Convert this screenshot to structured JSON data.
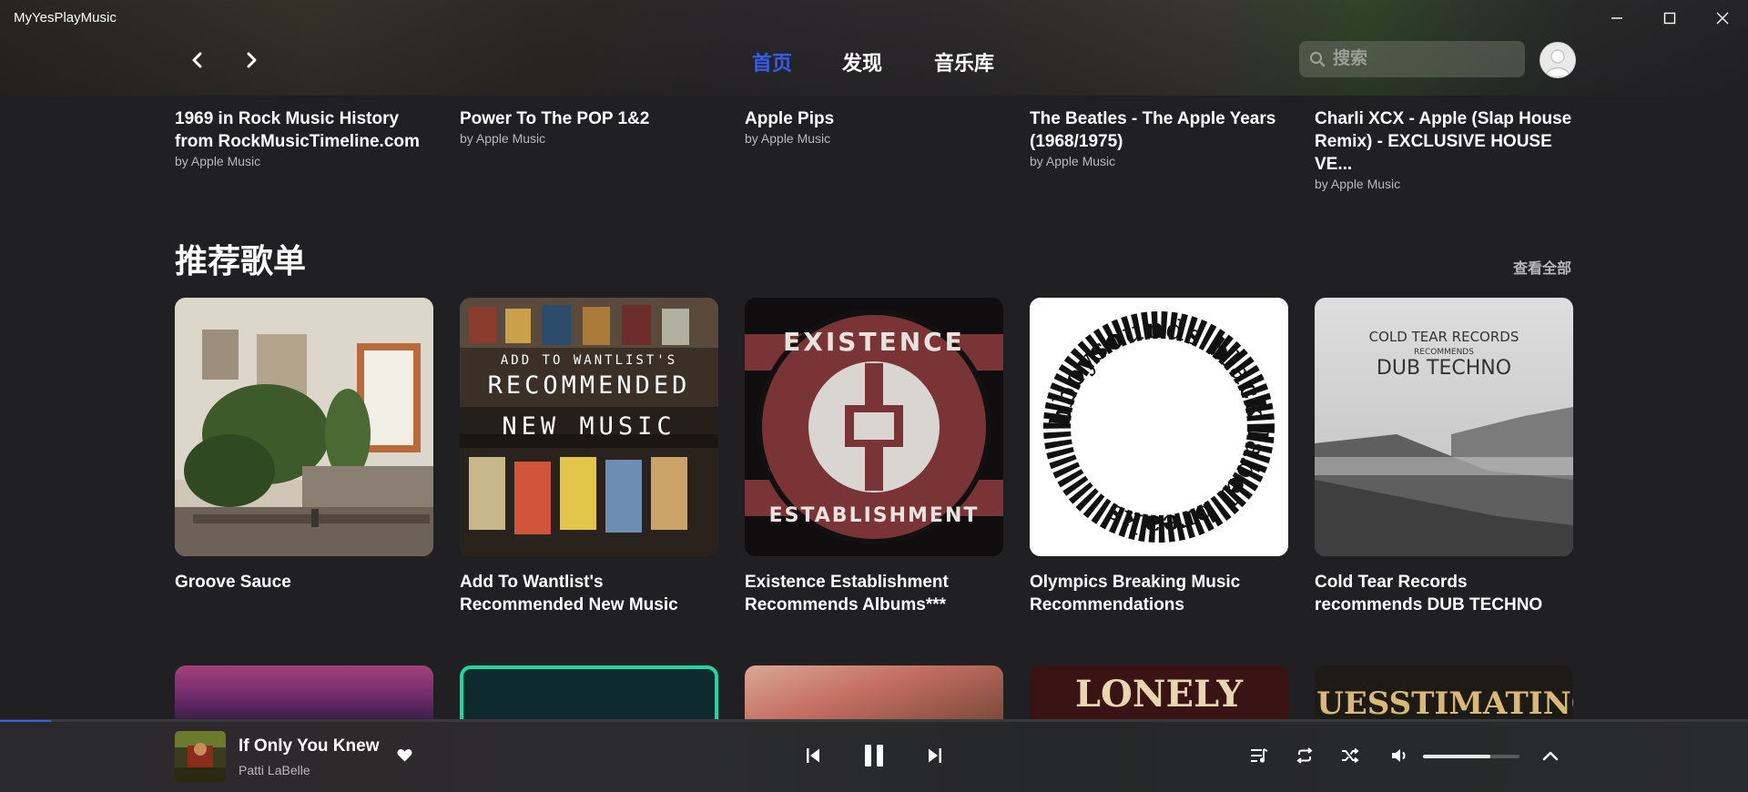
{
  "window": {
    "title": "MyYesPlayMusic"
  },
  "nav": {
    "links": [
      "首页",
      "发现",
      "音乐库"
    ],
    "search_placeholder": "搜索"
  },
  "top_row": [
    {
      "title": "1969 in Rock Music History from RockMusicTimeline.com",
      "sub": "by Apple Music"
    },
    {
      "title": "Power To The POP 1&2",
      "sub": "by Apple Music"
    },
    {
      "title": "Apple Pips",
      "sub": "by Apple Music"
    },
    {
      "title": "The Beatles - The Apple Years (1968/1975)",
      "sub": "by Apple Music"
    },
    {
      "title": "Charli XCX - Apple (Slap House Remix) - EXCLUSIVE HOUSE VE...",
      "sub": "by Apple Music"
    }
  ],
  "section": {
    "title": "推荐歌单",
    "see_all": "查看全部"
  },
  "playlists": [
    {
      "title": "Groove Sauce"
    },
    {
      "title": "Add To Wantlist's Recommended New Music",
      "cover_line1": "ADD TO WANTLIST'S",
      "cover_line2": "RECOMMENDED",
      "cover_line3": "NEW MUSIC"
    },
    {
      "title": "Existence Establishment Recommends Albums***",
      "cover_top": "EXISTENCE",
      "cover_bottom": "ESTABLISHMENT"
    },
    {
      "title": "Olympics Breaking Music Recommendations",
      "cover_text": "bboysounds black label breaks"
    },
    {
      "title": "Cold Tear Records recommends DUB TECHNO",
      "cover_line1": "COLD TEAR RECORDS",
      "cover_line2": "RECOMMENDS",
      "cover_line3": "DUB TECHNO"
    }
  ],
  "next_row": [
    {
      "cover_text": ""
    },
    {
      "cover_text": ""
    },
    {
      "cover_text": ""
    },
    {
      "cover_text": "LONELY SOUL PLANET"
    },
    {
      "cover_text": "GUESSTIMATING"
    }
  ],
  "player": {
    "song": "If Only You Knew",
    "artist": "Patti LaBelle",
    "progress": 0.029,
    "volume": 0.7
  },
  "colors": {
    "accent": "#335eea",
    "background": "#202022",
    "secondary_text": "#b9b9b9"
  }
}
